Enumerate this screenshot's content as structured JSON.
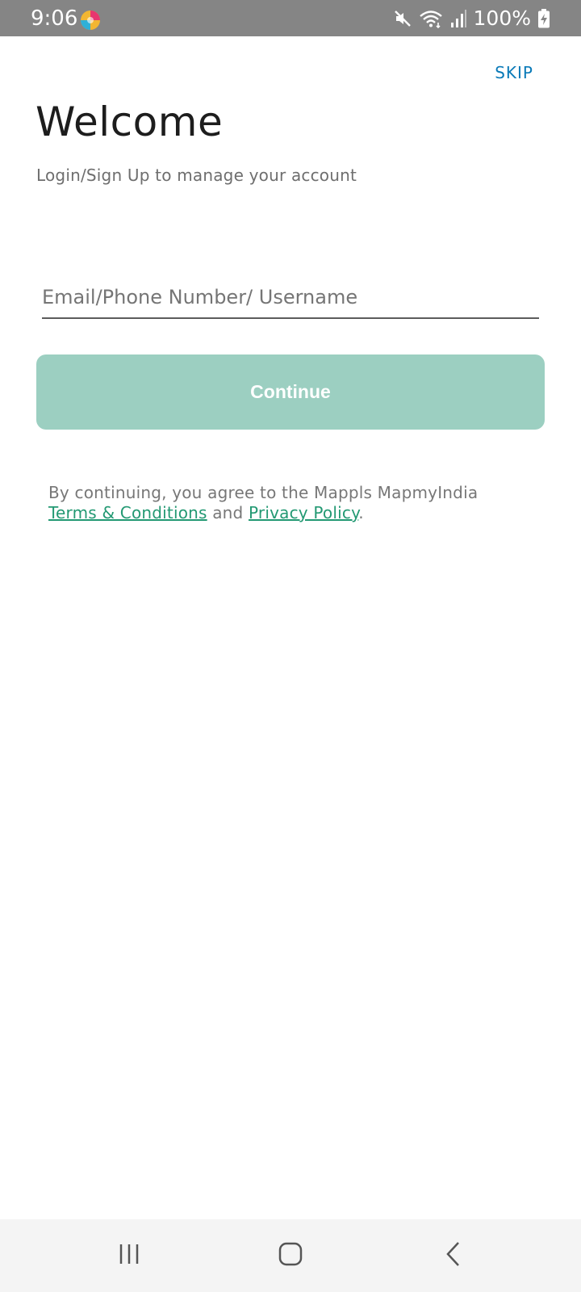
{
  "status_bar": {
    "time": "9:06",
    "battery": "100%",
    "icons": [
      "app-badge-icon",
      "mute-icon",
      "wifi-icon",
      "signal-icon",
      "battery-charging-icon"
    ]
  },
  "header": {
    "skip_label": "SKIP"
  },
  "main": {
    "title": "Welcome",
    "subtitle": "Login/Sign Up to manage your account",
    "input_placeholder": "Email/Phone Number/ Username",
    "input_value": "",
    "continue_label": "Continue",
    "terms_prefix": "By continuing, you agree to the Mappls MapmyIndia",
    "terms_link": "Terms & Conditions",
    "terms_and": " and ",
    "privacy_link": "Privacy Policy",
    "terms_suffix": "."
  },
  "colors": {
    "status_bar": "#858585",
    "accent": "#0a7ab8",
    "button": "#9ccfc1",
    "link": "#239973"
  },
  "nav_bar": {
    "icons": [
      "recent-apps-icon",
      "home-icon",
      "back-icon"
    ]
  }
}
